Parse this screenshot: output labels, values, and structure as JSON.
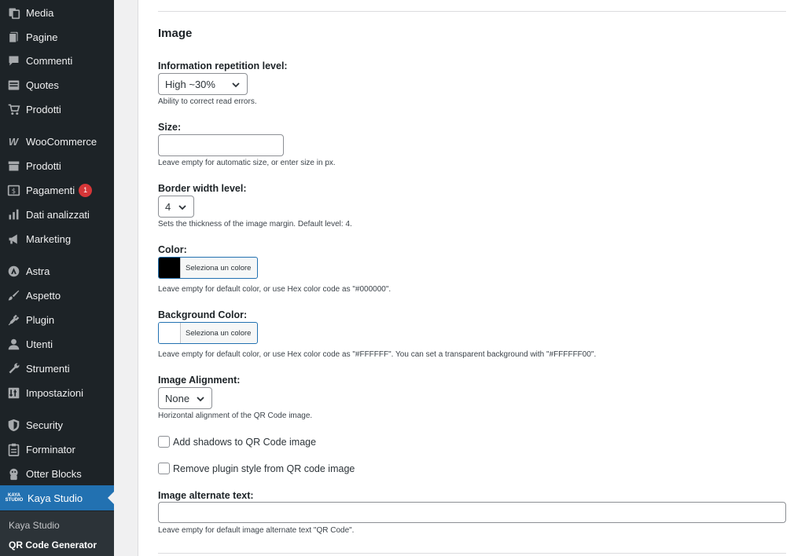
{
  "sidebar": {
    "items": [
      {
        "label": "Media",
        "icon": "media-icon"
      },
      {
        "label": "Pagine",
        "icon": "pages-icon"
      },
      {
        "label": "Commenti",
        "icon": "comments-icon"
      },
      {
        "label": "Quotes",
        "icon": "quotes-icon"
      },
      {
        "label": "Prodotti",
        "icon": "cart-icon"
      },
      {
        "label": "WooCommerce",
        "icon": "woocommerce-icon"
      },
      {
        "label": "Prodotti",
        "icon": "archive-icon"
      },
      {
        "label": "Pagamenti",
        "icon": "payments-icon",
        "badge": "1"
      },
      {
        "label": "Dati analizzati",
        "icon": "analytics-icon"
      },
      {
        "label": "Marketing",
        "icon": "megaphone-icon"
      },
      {
        "label": "Astra",
        "icon": "astra-icon"
      },
      {
        "label": "Aspetto",
        "icon": "brush-icon"
      },
      {
        "label": "Plugin",
        "icon": "plugin-icon"
      },
      {
        "label": "Utenti",
        "icon": "users-icon"
      },
      {
        "label": "Strumenti",
        "icon": "wrench-icon"
      },
      {
        "label": "Impostazioni",
        "icon": "settings-icon"
      },
      {
        "label": "Security",
        "icon": "shield-icon"
      },
      {
        "label": "Forminator",
        "icon": "clipboard-icon"
      },
      {
        "label": "Otter Blocks",
        "icon": "otter-icon"
      },
      {
        "label": "Kaya Studio",
        "icon": "kaya-logo-icon",
        "logo_text": "KAYA STUDIO"
      }
    ],
    "submenu": [
      {
        "label": "Kaya Studio"
      },
      {
        "label": "QR Code Generator"
      }
    ]
  },
  "main": {
    "section_title": "Image",
    "fields": {
      "repetition": {
        "label": "Information repetition level:",
        "value": "High ~30%",
        "desc": "Ability to correct read errors."
      },
      "size": {
        "label": "Size:",
        "value": "",
        "desc": "Leave empty for automatic size, or enter size in px."
      },
      "border": {
        "label": "Border width level:",
        "value": "4",
        "desc": "Sets the thickness of the image margin. Default level: 4."
      },
      "color": {
        "label": "Color:",
        "button": "Seleziona un colore",
        "swatch": "#000000",
        "desc": "Leave empty for default color, or use Hex color code as \"#000000\"."
      },
      "bgcolor": {
        "label": "Background Color:",
        "button": "Seleziona un colore",
        "swatch": "#ffffff",
        "desc": "Leave empty for default color, or use Hex color code as \"#FFFFFF\". You can set a transparent background with \"#FFFFFF00\"."
      },
      "alignment": {
        "label": "Image Alignment:",
        "value": "None",
        "desc": "Horizontal alignment of the QR Code image."
      },
      "shadows": {
        "label": "Add shadows to QR Code image",
        "checked": false
      },
      "remove_style": {
        "label": "Remove plugin style from QR code image",
        "checked": false
      },
      "alt_text": {
        "label": "Image alternate text:",
        "value": "",
        "desc": "Leave empty for default image alternate text \"QR Code\"."
      }
    }
  },
  "colors": {
    "sidebar_bg": "#1d2327",
    "accent": "#2271b1",
    "badge": "#d63638"
  }
}
